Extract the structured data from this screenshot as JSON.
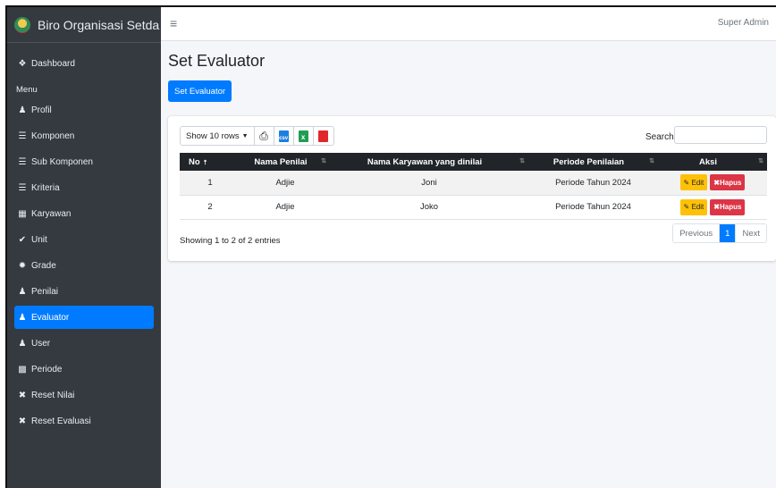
{
  "brand": {
    "title": "Biro Organisasi Setda Su"
  },
  "topbar": {
    "menu_icon": "hamburger-icon",
    "user": "Super Admin"
  },
  "sidebar": {
    "dashboard": "Dashboard",
    "menu_header": "Menu",
    "items": [
      {
        "label": "Profil",
        "icon": "user-icon"
      },
      {
        "label": "Komponen",
        "icon": "list-icon"
      },
      {
        "label": "Sub Komponen",
        "icon": "list-icon"
      },
      {
        "label": "Kriteria",
        "icon": "list-icon"
      },
      {
        "label": "Karyawan",
        "icon": "building-icon"
      },
      {
        "label": "Unit",
        "icon": "check-icon"
      },
      {
        "label": "Grade",
        "icon": "gear-icon"
      },
      {
        "label": "Penilai",
        "icon": "user-icon"
      },
      {
        "label": "Evaluator",
        "icon": "user-icon",
        "active": true
      },
      {
        "label": "User",
        "icon": "users-icon"
      },
      {
        "label": "Periode",
        "icon": "calendar-icon"
      },
      {
        "label": "Reset Nilai",
        "icon": "x-icon"
      },
      {
        "label": "Reset Evaluasi",
        "icon": "x-icon"
      }
    ]
  },
  "main": {
    "title": "Set Evaluator",
    "add_button": "Set Evaluator",
    "toolbar": {
      "rows": "Show 10 rows",
      "csv": "csv",
      "excel": "x"
    },
    "search": {
      "label": "Search:",
      "value": ""
    },
    "table": {
      "headers": [
        "No",
        "Nama Penilai",
        "Nama Karyawan yang dinilai",
        "Periode Penilaian",
        "Aksi"
      ],
      "rows": [
        {
          "no": "1",
          "penilai": "Adjie",
          "karyawan": "Joni",
          "periode": "Periode Tahun 2024"
        },
        {
          "no": "2",
          "penilai": "Adjie",
          "karyawan": "Joko",
          "periode": "Periode Tahun 2024"
        }
      ],
      "edit_label": "Edit",
      "delete_label": "Hapus"
    },
    "info": "Showing 1 to 2 of 2 entries",
    "pagination": {
      "previous": "Previous",
      "current": "1",
      "next": "Next"
    }
  },
  "colors": {
    "sidebar": "#343a40",
    "primary": "#007bff",
    "warning": "#ffc107",
    "danger": "#dc3545",
    "header": "#212529"
  }
}
